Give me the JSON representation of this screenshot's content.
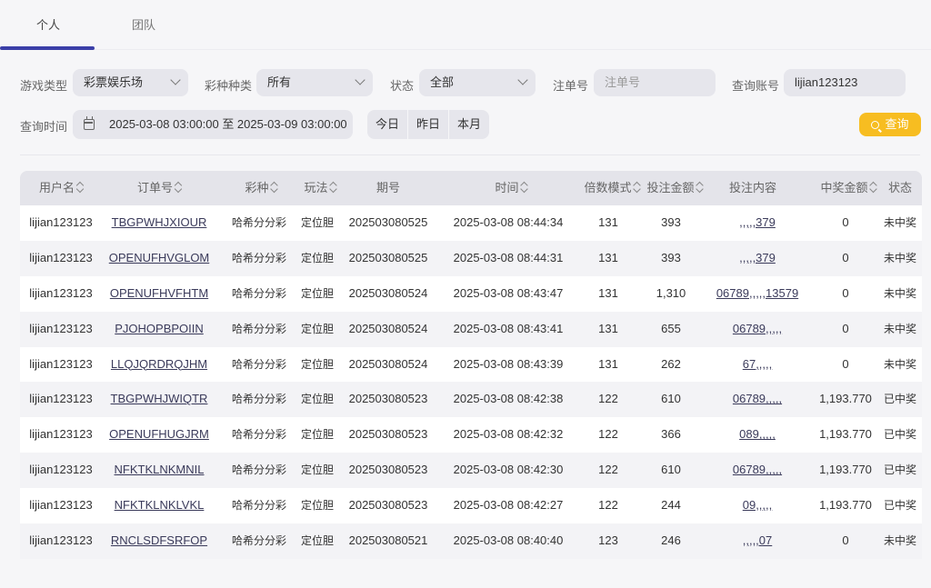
{
  "tabs": {
    "personal": "个人",
    "team": "团队"
  },
  "filters": {
    "game_type_label": "游戏类型",
    "game_type_value": "彩票娱乐场",
    "lottery_kind_label": "彩种种类",
    "lottery_kind_value": "所有",
    "status_label": "状态",
    "status_value": "全部",
    "order_no_label": "注单号",
    "order_no_placeholder": "注单号",
    "account_label": "查询账号",
    "account_value": "lijian123123",
    "time_label": "查询时间",
    "date_range": "2025-03-08 03:00:00 至 2025-03-09 03:00:00",
    "today": "今日",
    "yesterday": "昨日",
    "this_month": "本月",
    "search": "查询"
  },
  "table": {
    "headers": {
      "user": "用户名",
      "order": "订单号",
      "lottery": "彩种",
      "play": "玩法",
      "issue": "期号",
      "time": "时间",
      "multiple": "倍数模式",
      "amount": "投注金额",
      "content": "投注内容",
      "prize": "中奖金额",
      "status": "状态"
    },
    "rows": [
      {
        "user": "lijian123123",
        "order": "TBGPWHJXIOUR",
        "lottery": "哈希分分彩",
        "play": "定位胆",
        "issue": "202503080525",
        "time": "2025-03-08 08:44:34",
        "multiple": "131",
        "amount": "393",
        "content": ",,,,,379",
        "prize": "0",
        "status": "未中奖"
      },
      {
        "user": "lijian123123",
        "order": "OPENUFHVGLOM",
        "lottery": "哈希分分彩",
        "play": "定位胆",
        "issue": "202503080525",
        "time": "2025-03-08 08:44:31",
        "multiple": "131",
        "amount": "393",
        "content": ",,,,,379",
        "prize": "0",
        "status": "未中奖"
      },
      {
        "user": "lijian123123",
        "order": "OPENUFHVFHTM",
        "lottery": "哈希分分彩",
        "play": "定位胆",
        "issue": "202503080524",
        "time": "2025-03-08 08:43:47",
        "multiple": "131",
        "amount": "1,310",
        "content": "06789,,,,,13579",
        "prize": "0",
        "status": "未中奖"
      },
      {
        "user": "lijian123123",
        "order": "PJOHOPBPOIIN",
        "lottery": "哈希分分彩",
        "play": "定位胆",
        "issue": "202503080524",
        "time": "2025-03-08 08:43:41",
        "multiple": "131",
        "amount": "655",
        "content": "06789,,,,,",
        "prize": "0",
        "status": "未中奖"
      },
      {
        "user": "lijian123123",
        "order": "LLQJQRDRQJHM",
        "lottery": "哈希分分彩",
        "play": "定位胆",
        "issue": "202503080524",
        "time": "2025-03-08 08:43:39",
        "multiple": "131",
        "amount": "262",
        "content": "67,,,,,",
        "prize": "0",
        "status": "未中奖"
      },
      {
        "user": "lijian123123",
        "order": "TBGPWHJWIQTR",
        "lottery": "哈希分分彩",
        "play": "定位胆",
        "issue": "202503080523",
        "time": "2025-03-08 08:42:38",
        "multiple": "122",
        "amount": "610",
        "content": "06789,,,,,",
        "prize": "1,193.770",
        "status": "已中奖"
      },
      {
        "user": "lijian123123",
        "order": "OPENUFHUGJRM",
        "lottery": "哈希分分彩",
        "play": "定位胆",
        "issue": "202503080523",
        "time": "2025-03-08 08:42:32",
        "multiple": "122",
        "amount": "366",
        "content": "089,,,,,",
        "prize": "1,193.770",
        "status": "已中奖"
      },
      {
        "user": "lijian123123",
        "order": "NFKTKLNKMNIL",
        "lottery": "哈希分分彩",
        "play": "定位胆",
        "issue": "202503080523",
        "time": "2025-03-08 08:42:30",
        "multiple": "122",
        "amount": "610",
        "content": "06789,,,,,",
        "prize": "1,193.770",
        "status": "已中奖"
      },
      {
        "user": "lijian123123",
        "order": "NFKTKLNKLVKL",
        "lottery": "哈希分分彩",
        "play": "定位胆",
        "issue": "202503080523",
        "time": "2025-03-08 08:42:27",
        "multiple": "122",
        "amount": "244",
        "content": "09,,,,,",
        "prize": "1,193.770",
        "status": "已中奖"
      },
      {
        "user": "lijian123123",
        "order": "RNCLSDFSRFOP",
        "lottery": "哈希分分彩",
        "play": "定位胆",
        "issue": "202503080521",
        "time": "2025-03-08 08:40:40",
        "multiple": "123",
        "amount": "246",
        "content": ",,,,,07",
        "prize": "0",
        "status": "未中奖"
      }
    ]
  },
  "colors": {
    "accent": "#3b3fa8",
    "search_button": "#f7bd21"
  }
}
